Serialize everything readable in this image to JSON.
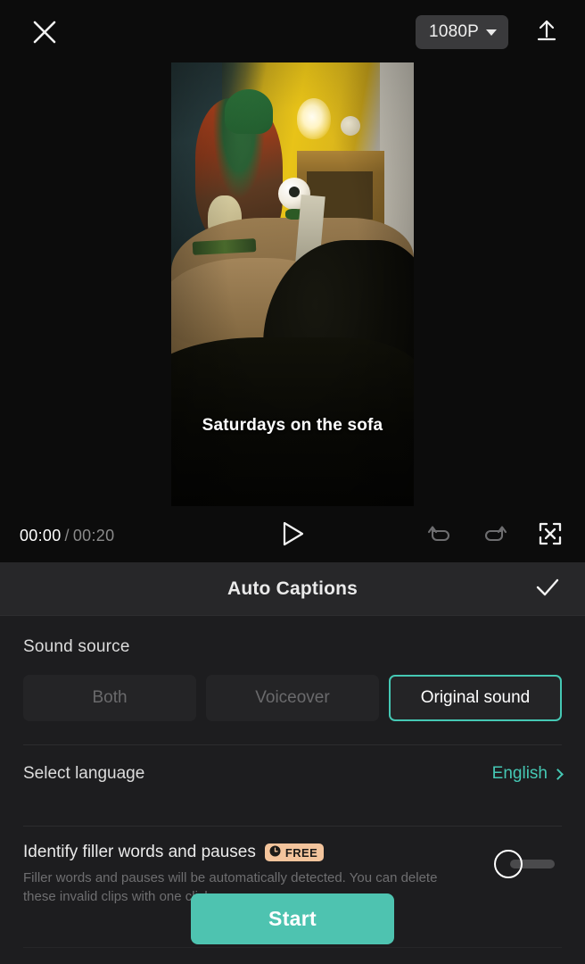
{
  "topbar": {
    "close_icon": "close-icon",
    "resolution": "1080P",
    "resolution_caret_icon": "chevron-down-icon",
    "export_icon": "upload-icon"
  },
  "preview": {
    "caption_text": "Saturdays on the sofa",
    "scene_description": "black shaggy dog lying on a tan sofa in a living room with a yellow wall, lamp and plush toys"
  },
  "playbar": {
    "current_time": "00:00",
    "separator": "/",
    "total_time": "00:20",
    "play_icon": "play-icon",
    "undo_icon": "undo-icon",
    "redo_icon": "redo-icon",
    "fullscreen_icon": "fullscreen-icon"
  },
  "panel": {
    "title": "Auto Captions",
    "confirm_icon": "check-icon",
    "sound_source": {
      "label": "Sound source",
      "options": [
        {
          "label": "Both",
          "state": "disabled"
        },
        {
          "label": "Voiceover",
          "state": "disabled"
        },
        {
          "label": "Original sound",
          "state": "selected"
        }
      ]
    },
    "language": {
      "label": "Select language",
      "value": "English",
      "chevron_icon": "chevron-right-icon"
    },
    "filler_words": {
      "label": "Identify filler words and pauses",
      "badge": "FREE",
      "badge_icon": "clock-icon",
      "description": "Filler words and pauses will be automatically detected. You can delete these invalid clips with one click.",
      "toggle_state": "off"
    },
    "start_button": "Start"
  },
  "colors": {
    "accent_teal": "#4ec3b0",
    "selected_border": "#45c8b4",
    "badge_bg": "#f3c49c",
    "panel_bg": "#1d1d1f",
    "app_bg": "#0c0c0c"
  }
}
